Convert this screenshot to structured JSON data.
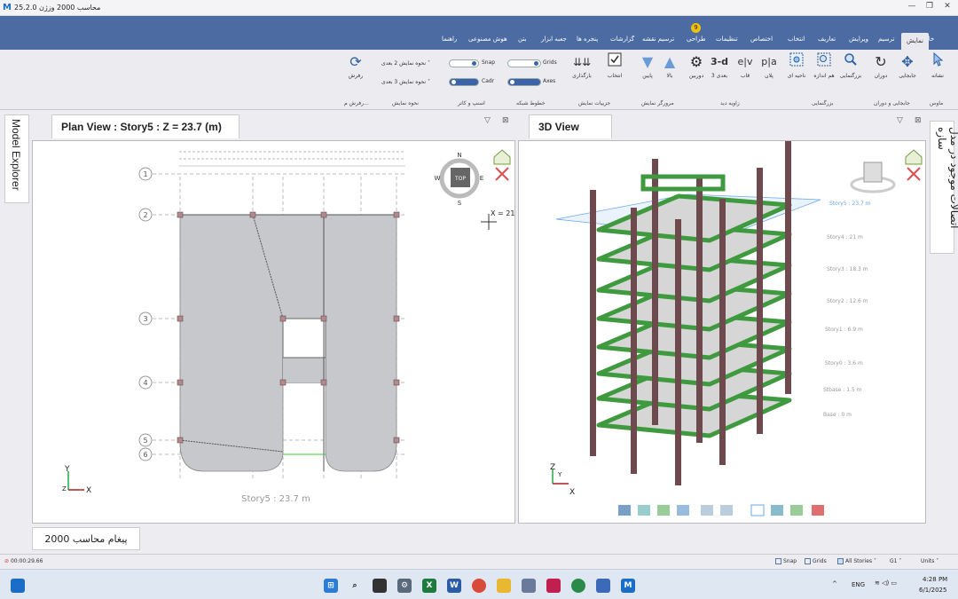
{
  "window": {
    "title": "محاسب 2000 وزژن 25.2.0",
    "logo_text": "M",
    "minimize": "—",
    "restore": "❐",
    "close": "✕"
  },
  "ribbon_tabs": [
    {
      "label": "خانه"
    },
    {
      "label": "نمایش"
    },
    {
      "label": "ترسیم"
    },
    {
      "label": "ویرایش"
    },
    {
      "label": "تعاریف"
    },
    {
      "label": "انتخاب"
    },
    {
      "label": "اختصاص"
    },
    {
      "label": "تنظیمات"
    },
    {
      "label": "طراحی"
    },
    {
      "label": "ترسیم نقشه"
    },
    {
      "label": "گزارشات"
    },
    {
      "label": "پنجره ها"
    },
    {
      "label": "جعبه ابزار"
    },
    {
      "label": "بتن"
    },
    {
      "label": "هوش مصنوعی"
    },
    {
      "label": "راهنما"
    }
  ],
  "badge": "9",
  "ribbon": {
    "buttons": [
      {
        "label": "نشانه",
        "icon": "cursor-icon"
      },
      {
        "label": "جابجایی",
        "icon": "move-icon"
      },
      {
        "label": "دوران",
        "icon": "rotate-icon"
      },
      {
        "label": "بزرگنمایی",
        "icon": "zoom-icon"
      },
      {
        "label": "هم اندازه",
        "icon": "zoom-fit-icon"
      },
      {
        "label": "ناحیه ای",
        "icon": "zoom-window-icon"
      },
      {
        "label": "پلان",
        "icon": "plan-icon",
        "glyph": "p|a"
      },
      {
        "label": "قاب",
        "icon": "elevation-icon",
        "glyph": "e|v"
      },
      {
        "label": "3 بعدی",
        "icon": "3d-icon",
        "glyph": "3-d"
      },
      {
        "label": "دوربین",
        "icon": "camera-icon"
      },
      {
        "label": "بالا",
        "icon": "up-arrow-icon"
      },
      {
        "label": "پایین",
        "icon": "down-arrow-icon"
      },
      {
        "label": "انتخاب",
        "icon": "check-icon"
      },
      {
        "label": "بارگذاری",
        "icon": "load-icon"
      },
      {
        "label": "رفرش",
        "icon": "refresh-icon"
      }
    ],
    "groups": {
      "tools": "ماوس",
      "move_rotate": "جابجایی و دوران",
      "zoom": "بزرگنمایی",
      "view_angle": "زاویه دید",
      "explorer": "مرورگر نمایش",
      "display_details": "جزییات نمایش",
      "grid_lines": "خطوط شبکه",
      "snap_cursor": "اسنپ و کاتر",
      "display_mode": "نحوه نمایش",
      "refresh_group": "رفرش م..."
    },
    "toggles": {
      "snap": "Snap",
      "grids": "Grids",
      "cadr": "Cadr",
      "axes": "Axes"
    },
    "dropdowns": {
      "display_2d": "نحوه نمایش 2 بعدی",
      "display_3d": "نحوه نمایش 3 بعدی"
    }
  },
  "side": {
    "model_explorer": "Model Explorer",
    "right_panel": "اتصالات موجود در مدل سازه"
  },
  "plan_view": {
    "title": "Plan View : Story5 : Z = 23.7 (m)",
    "footer": "Story5 : 23.7 m",
    "cursor_readout": "X = 21",
    "compass": {
      "n": "N",
      "s": "S",
      "e": "E",
      "w": "W",
      "top": "TOP"
    },
    "grid_bubbles": [
      "1",
      "2",
      "3",
      "4",
      "5",
      "6"
    ],
    "axis": {
      "x": "X",
      "y": "Y",
      "z": "Z"
    }
  },
  "view3d": {
    "title": "3D View",
    "story_labels": [
      "Story5 : 23.7 m",
      "Story4 : 21 m",
      "Story3 : 18.3 m",
      "Story2 : 12.6 m",
      "Story1 : 6.9 m",
      "Story0 : 3.6 m",
      "Stbase : 1.5 m",
      "Base : 0 m"
    ],
    "axis": {
      "x": "X",
      "y": "Y",
      "z": "Z"
    }
  },
  "message_tab": "پیغام محاسب 2000",
  "status": {
    "timer": "00:00:29.66",
    "snap": "Snap",
    "grids": "Grids",
    "stories": "All Stories",
    "group": "G1",
    "units": "Units"
  },
  "taskbar": {
    "lang": "ENG",
    "time": "4:28 PM",
    "date": "6/1/2025"
  },
  "colors": {
    "accent": "#4c6ba3",
    "slab_plan": "#c6c8cb",
    "beam_3d": "#3f9a3f",
    "column_3d": "#6e4a4e"
  }
}
